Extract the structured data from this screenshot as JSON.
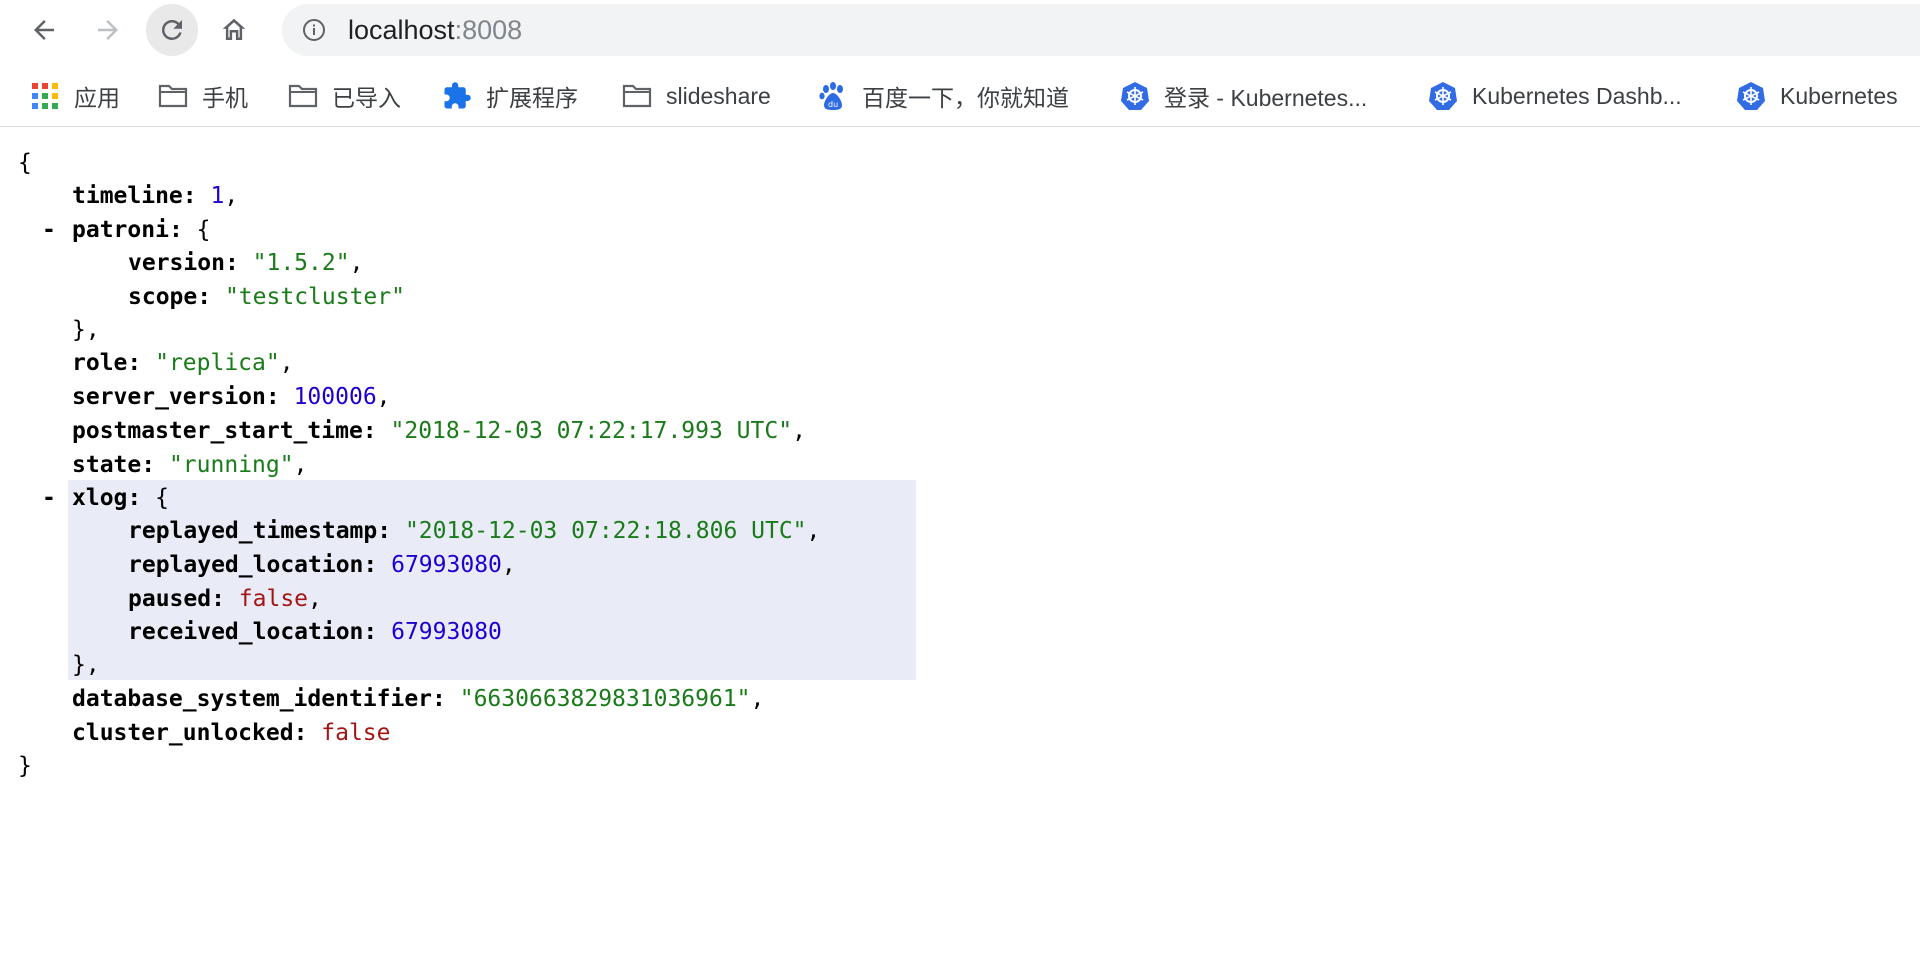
{
  "toolbar": {
    "url_host": "localhost",
    "url_port": ":8008"
  },
  "bookmarks": [
    {
      "label": "应用",
      "icon": "apps-grid-icon"
    },
    {
      "label": "手机",
      "icon": "folder-icon"
    },
    {
      "label": "已导入",
      "icon": "folder-icon"
    },
    {
      "label": "扩展程序",
      "icon": "puzzle-extension-icon"
    },
    {
      "label": "slideshare",
      "icon": "folder-icon"
    },
    {
      "label": "百度一下，你就知道",
      "icon": "baidu-paw-icon"
    },
    {
      "label": "登录 - Kubernetes...",
      "icon": "kubernetes-icon"
    },
    {
      "label": "Kubernetes Dashb...",
      "icon": "kubernetes-icon"
    },
    {
      "label": "Kubernetes",
      "icon": "kubernetes-icon"
    }
  ],
  "json_view": {
    "open_brace": "{",
    "close_brace": "}",
    "collapse_marker": "-",
    "timeline": {
      "key": "timeline",
      "value": "1"
    },
    "patroni": {
      "key": "patroni",
      "version": {
        "key": "version",
        "value": "\"1.5.2\""
      },
      "scope": {
        "key": "scope",
        "value": "\"testcluster\""
      }
    },
    "role": {
      "key": "role",
      "value": "\"replica\""
    },
    "server_version": {
      "key": "server_version",
      "value": "100006"
    },
    "postmaster_start_time": {
      "key": "postmaster_start_time",
      "value": "\"2018-12-03 07:22:17.993 UTC\""
    },
    "state": {
      "key": "state",
      "value": "\"running\""
    },
    "xlog": {
      "key": "xlog",
      "replayed_timestamp": {
        "key": "replayed_timestamp",
        "value": "\"2018-12-03 07:22:18.806 UTC\""
      },
      "replayed_location": {
        "key": "replayed_location",
        "value": "67993080"
      },
      "paused": {
        "key": "paused",
        "value": "false"
      },
      "received_location": {
        "key": "received_location",
        "value": "67993080"
      }
    },
    "database_system_identifier": {
      "key": "database_system_identifier",
      "value": "\"6630663829831036961\""
    },
    "cluster_unlocked": {
      "key": "cluster_unlocked",
      "value": "false"
    }
  },
  "colors": {
    "string": "#1a7b1a",
    "number": "#1c00cf",
    "boolean": "#a31515",
    "highlight": "#e9ebf6"
  }
}
